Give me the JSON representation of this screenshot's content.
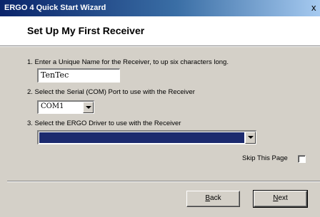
{
  "window": {
    "title": "ERGO 4 Quick Start Wizard",
    "close_glyph": "x"
  },
  "header": {
    "title": "Set Up My First Receiver"
  },
  "steps": [
    {
      "label": "1.  Enter a Unique Name for the Receiver, to up six characters long."
    },
    {
      "label": "2.  Select the Serial (COM) Port to use with the Receiver"
    },
    {
      "label": "3.  Select the ERGO Driver to use with the Receiver"
    }
  ],
  "receiver_name": {
    "value": "TenTec"
  },
  "com_port": {
    "selected": "COM1"
  },
  "driver": {
    "selected": ""
  },
  "skip": {
    "label": "Skip This Page",
    "checked": false
  },
  "buttons": {
    "back_mnemonic": "B",
    "back_rest": "ack",
    "next_mnemonic": "N",
    "next_rest": "ext"
  },
  "colors": {
    "titlebar_start": "#0a246a",
    "titlebar_end": "#a6caf0",
    "driver_highlight": "#1c2a6e",
    "window_face": "#d4d0c8"
  },
  "icons": {
    "close": "close-icon",
    "dropdown": "chevron-down-icon"
  }
}
